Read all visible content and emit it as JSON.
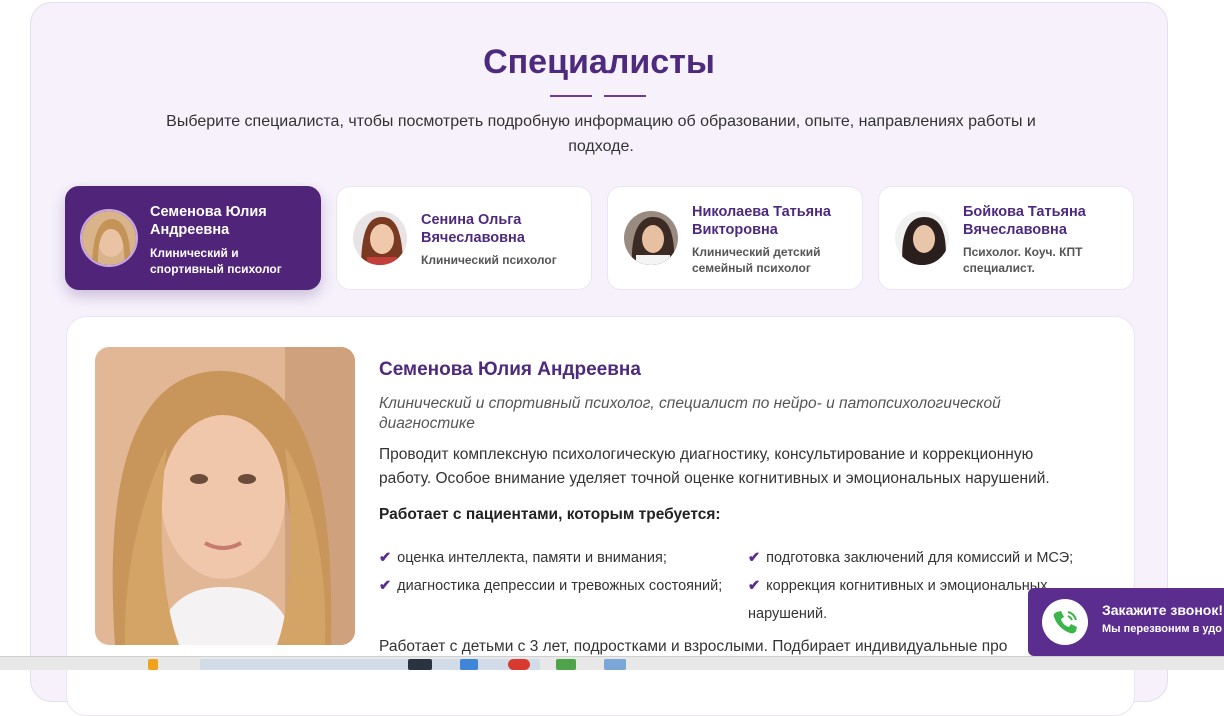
{
  "section": {
    "title": "Специалисты",
    "subtitle": "Выберите специалиста, чтобы посмотреть подробную информацию об образовании, опыте, направлениях работы и подходе."
  },
  "specialists": [
    {
      "name": "Семенова Юлия Андреевна",
      "role": "Клинический и спортивный психолог",
      "active": true
    },
    {
      "name": "Сенина Ольга Вячеславовна",
      "role": "Клинический психолог",
      "active": false
    },
    {
      "name": "Николаева Татьяна Викторовна",
      "role": "Клинический детский семейный психолог",
      "active": false
    },
    {
      "name": "Бойкова Татьяна Вячеславовна",
      "role": "Психолог. Коуч. КПТ специалист.",
      "active": false
    }
  ],
  "profile": {
    "name": "Семенова Юлия Андреевна",
    "role": "Клинический и спортивный психолог, специалист по нейро- и патопсихологической диагностике",
    "description": "Проводит комплексную психологическую диагностику, консультирование и коррекционную работу. Особое внимание уделяет точной оценке когнитивных и эмоциональных нарушений.",
    "works_with_title": "Работает с пациентами, которым требуется:",
    "works_with": [
      "оценка интеллекта, памяти и внимания;",
      "подготовка заключений для комиссий и МСЭ;",
      "диагностика депрессии и тревожных состояний;",
      "коррекция когнитивных и эмоциональных нарушений."
    ],
    "tail": "Работает с детьми с 3 лет, подростками и взрослыми. Подбирает индивидуальные про"
  },
  "callback": {
    "title": "Закажите звонок!",
    "subtitle": "Мы перезвоним в удо",
    "icon": "phone-icon"
  },
  "colors": {
    "accent": "#4f2479",
    "title": "#4e2a7f",
    "background": "#f6f1fb"
  }
}
